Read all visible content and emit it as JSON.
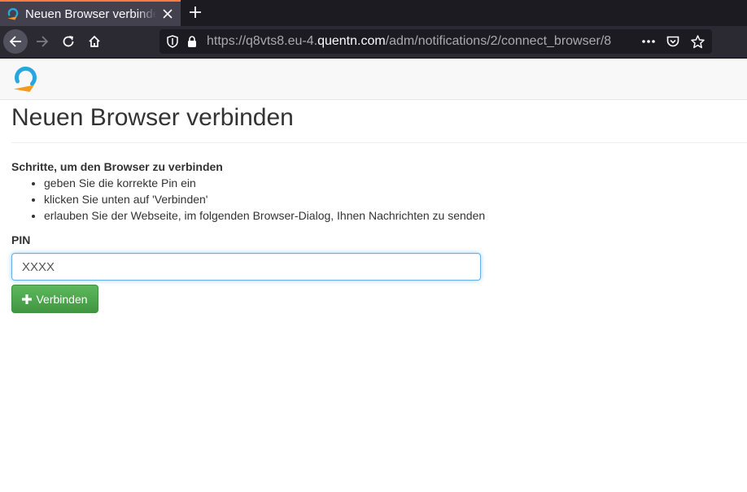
{
  "browser": {
    "tab": {
      "title": "Neuen Browser verbinden",
      "favicon": "quentn-logo-icon",
      "close_icon": "close-icon"
    },
    "new_tab_icon": "plus-icon",
    "nav": {
      "back_icon": "arrow-left-icon",
      "forward_icon": "arrow-right-icon",
      "reload_icon": "reload-icon",
      "home_icon": "home-icon"
    },
    "url": {
      "prefix": "https://q8vts8.eu-4.",
      "domain": "quentn.com",
      "path": "/adm/notifications/2/connect_browser/8",
      "tracking_icon": "shield-icon",
      "lock_icon": "lock-icon",
      "actions": [
        "more-icon",
        "pocket-icon",
        "star-icon"
      ]
    },
    "colors": {
      "tab_accent": "#ff7a3d",
      "chrome_dark": "#1c1b22",
      "chrome": "#2b2a33"
    }
  },
  "page": {
    "logo": "quentn-logo",
    "title": "Neuen Browser verbinden",
    "steps_heading": "Schritte, um den Browser zu verbinden",
    "steps": [
      "geben Sie die korrekte Pin ein",
      "klicken Sie unten auf 'Verbinden'",
      "erlauben Sie der Webseite, im folgenden Browser-Dialog, Ihnen Nachrichten zu senden"
    ],
    "pin_label": "PIN",
    "pin_placeholder": "XXXX",
    "pin_value": "",
    "connect_button": {
      "label": "Verbinden",
      "icon": "plus-icon"
    },
    "colors": {
      "button": "#5cb85c",
      "input_focus": "#66afe9",
      "logo_blue": "#2aa6df",
      "logo_orange": "#f39a1f"
    }
  }
}
